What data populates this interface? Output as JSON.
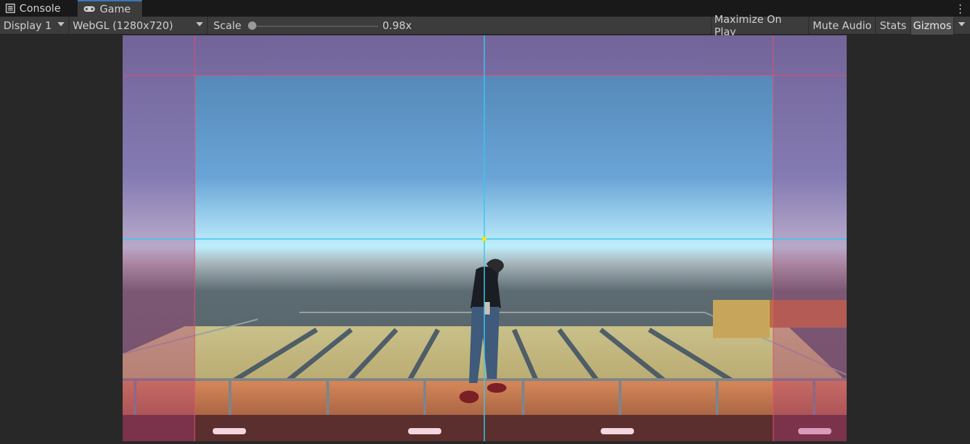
{
  "tabs": [
    {
      "label": "Console",
      "icon": "console-list-icon"
    },
    {
      "label": "Game",
      "icon": "gamepad-icon"
    }
  ],
  "toolbar": {
    "display": "Display 1",
    "resolution": "WebGL (1280x720)",
    "scale_label": "Scale",
    "scale_value": "0.98x",
    "scale_fraction": 0.0,
    "maximize_on_play": "Maximize On Play",
    "mute_audio": "Mute Audio",
    "stats": "Stats",
    "gizmos": "Gizmos"
  },
  "colors": {
    "editor_bg": "#282828",
    "tab_bar": "#191919",
    "toolbar": "#3c3c3c",
    "active_tab_accent": "#3a79bb",
    "crosshair": "#35c8f0",
    "safe_area_border": "#e0506e",
    "center_marker": "#ffe600"
  },
  "scene": {
    "description_icon": "character-on-rooftop-icon"
  }
}
